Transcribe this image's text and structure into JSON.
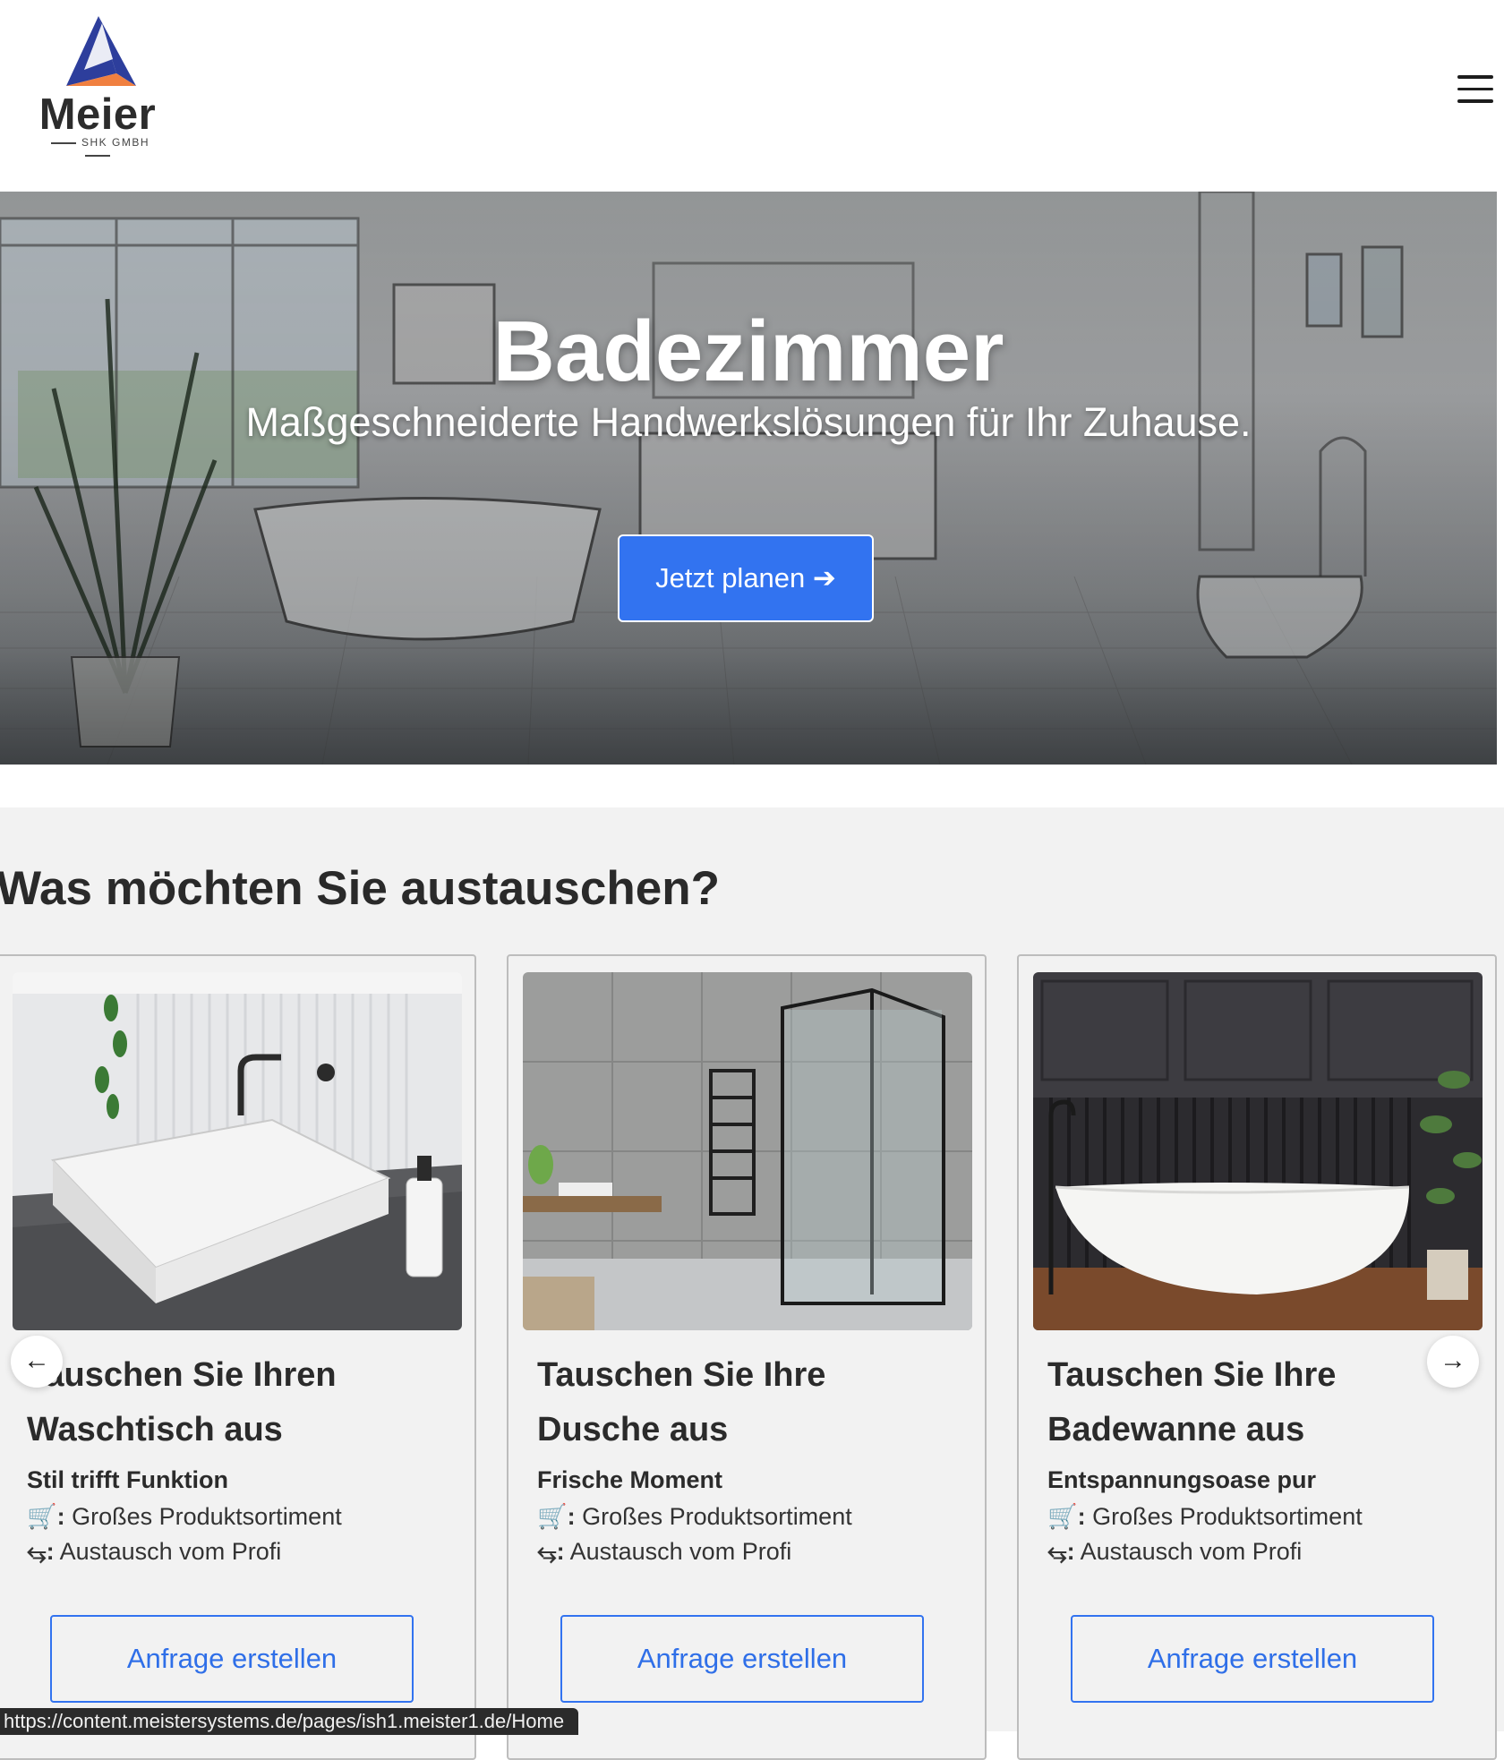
{
  "brand": {
    "name": "Meier",
    "subtitle": "SHK GMBH",
    "colors": {
      "triangle_top": "#2d3e9c",
      "triangle_bottom": "#f08040",
      "text": "#2c2c2c"
    }
  },
  "header": {
    "menu_icon": "hamburger-menu-icon"
  },
  "hero": {
    "title": "Badezimmer",
    "subtitle": "Maßgeschneiderte Handwerkslösungen für Ihr Zuhause.",
    "cta_label": "Jetzt planen ➔",
    "accent": "#3273f0"
  },
  "section": {
    "title": "Was möchten Sie austauschen?",
    "prev_icon": "←",
    "next_icon": "→"
  },
  "cards": [
    {
      "title": "Tauschen Sie Ihren Waschtisch aus",
      "tagline": "Stil trifft Funktion",
      "feature1_icon": "🛒:",
      "feature1": " Großes Produktsortiment",
      "feature2_icon": "⥃:",
      "feature2": " Austausch vom Profi",
      "button": "Anfrage erstellen",
      "image": "washbasin-image"
    },
    {
      "title": "Tauschen Sie Ihre Dusche aus",
      "tagline": "Frische Moment",
      "feature1_icon": "🛒:",
      "feature1": " Großes Produktsortiment",
      "feature2_icon": "⥃:",
      "feature2": " Austausch vom Profi",
      "button": "Anfrage erstellen",
      "image": "shower-image"
    },
    {
      "title": "Tauschen Sie Ihre Badewanne aus",
      "tagline": "Entspannungsoase pur",
      "feature1_icon": "🛒:",
      "feature1": " Großes Produktsortiment",
      "feature2_icon": "⥃:",
      "feature2": " Austausch vom Profi",
      "button": "Anfrage erstellen",
      "image": "bathtub-image"
    }
  ],
  "status_url": "https://content.meistersystems.de/pages/ish1.meister1.de/Home"
}
